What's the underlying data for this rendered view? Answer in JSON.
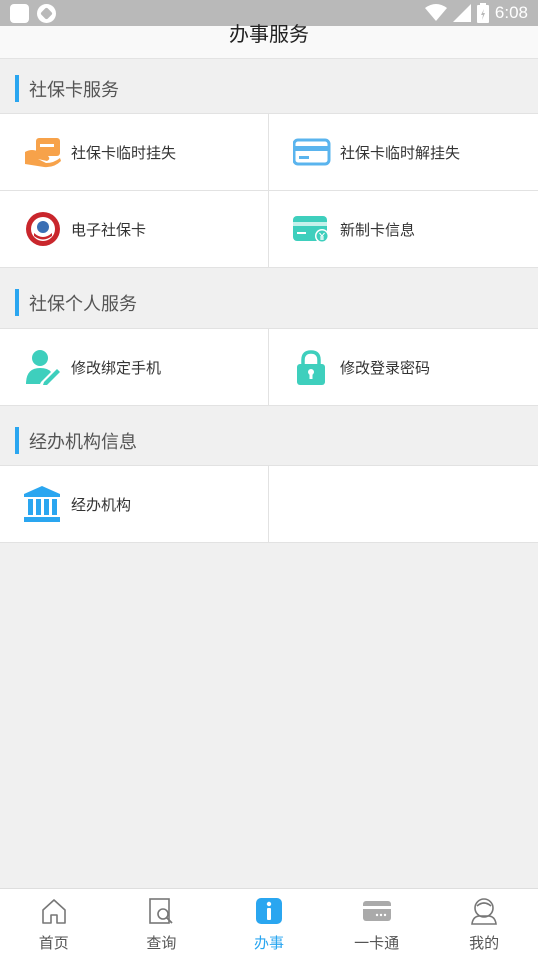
{
  "status_bar": {
    "time": "6:08"
  },
  "header": {
    "title": "办事服务"
  },
  "sections": [
    {
      "title": "社保卡服务",
      "items": [
        {
          "label": "社保卡临时挂失",
          "icon": "hand-card-icon"
        },
        {
          "label": "社保卡临时解挂失",
          "icon": "credit-card-icon"
        },
        {
          "label": "电子社保卡",
          "icon": "social-security-badge-icon"
        },
        {
          "label": "新制卡信息",
          "icon": "card-yen-icon"
        }
      ]
    },
    {
      "title": "社保个人服务",
      "items": [
        {
          "label": "修改绑定手机",
          "icon": "user-edit-icon"
        },
        {
          "label": "修改登录密码",
          "icon": "lock-icon"
        }
      ]
    },
    {
      "title": "经办机构信息",
      "items": [
        {
          "label": "经办机构",
          "icon": "bank-building-icon"
        }
      ]
    }
  ],
  "tabs": [
    {
      "label": "首页",
      "icon": "home-icon"
    },
    {
      "label": "查询",
      "icon": "search-doc-icon"
    },
    {
      "label": "办事",
      "icon": "info-icon",
      "active": true
    },
    {
      "label": "一卡通",
      "icon": "card-icon"
    },
    {
      "label": "我的",
      "icon": "user-icon"
    }
  ],
  "colors": {
    "accent": "#2aa6f0",
    "orange": "#f7a24a",
    "teal": "#3ecfbd",
    "blue": "#5ab4ee"
  }
}
